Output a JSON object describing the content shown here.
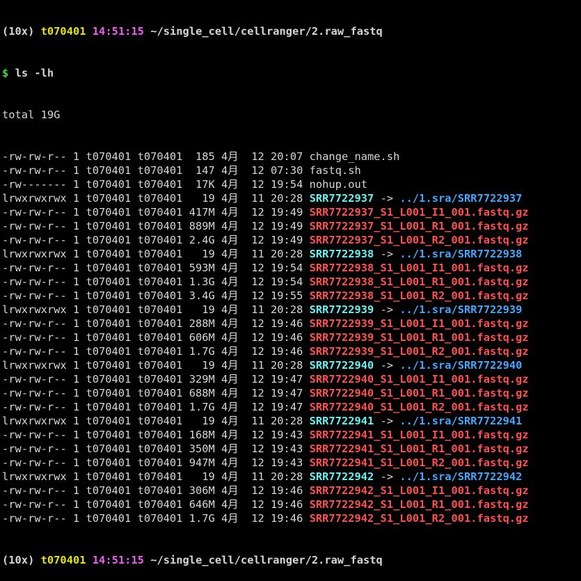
{
  "prompt": {
    "env": "(10x)",
    "user": "t070401",
    "time": "14:51:15",
    "path": "~/single_cell/cellranger/2.raw_fastq",
    "dollar": "$",
    "command": "ls -lh"
  },
  "total": "total 19G",
  "entries": [
    {
      "perm": "-rw-rw-r--",
      "links": "1",
      "owner": "t070401",
      "group": "t070401",
      "size": "185",
      "month": "4月",
      "day": "12",
      "time": "20:07",
      "name": "change_name.sh",
      "kind": "plain"
    },
    {
      "perm": "-rw-rw-r--",
      "links": "1",
      "owner": "t070401",
      "group": "t070401",
      "size": "147",
      "month": "4月",
      "day": "12",
      "time": "07:30",
      "name": "fastq.sh",
      "kind": "plain"
    },
    {
      "perm": "-rw-------",
      "links": "1",
      "owner": "t070401",
      "group": "t070401",
      "size": "17K",
      "month": "4月",
      "day": "12",
      "time": "19:54",
      "name": "nohup.out",
      "kind": "plain"
    },
    {
      "perm": "lrwxrwxrwx",
      "links": "1",
      "owner": "t070401",
      "group": "t070401",
      "size": "19",
      "month": "4月",
      "day": "11",
      "time": "20:28",
      "name": "SRR7722937",
      "kind": "link",
      "target": "../1.sra/SRR7722937"
    },
    {
      "perm": "-rw-rw-r--",
      "links": "1",
      "owner": "t070401",
      "group": "t070401",
      "size": "417M",
      "month": "4月",
      "day": "12",
      "time": "19:49",
      "name": "SRR7722937_S1_L001_I1_001.fastq.gz",
      "kind": "gz"
    },
    {
      "perm": "-rw-rw-r--",
      "links": "1",
      "owner": "t070401",
      "group": "t070401",
      "size": "889M",
      "month": "4月",
      "day": "12",
      "time": "19:49",
      "name": "SRR7722937_S1_L001_R1_001.fastq.gz",
      "kind": "gz"
    },
    {
      "perm": "-rw-rw-r--",
      "links": "1",
      "owner": "t070401",
      "group": "t070401",
      "size": "2.4G",
      "month": "4月",
      "day": "12",
      "time": "19:49",
      "name": "SRR7722937_S1_L001_R2_001.fastq.gz",
      "kind": "gz"
    },
    {
      "perm": "lrwxrwxrwx",
      "links": "1",
      "owner": "t070401",
      "group": "t070401",
      "size": "19",
      "month": "4月",
      "day": "11",
      "time": "20:28",
      "name": "SRR7722938",
      "kind": "link",
      "target": "../1.sra/SRR7722938"
    },
    {
      "perm": "-rw-rw-r--",
      "links": "1",
      "owner": "t070401",
      "group": "t070401",
      "size": "593M",
      "month": "4月",
      "day": "12",
      "time": "19:54",
      "name": "SRR7722938_S1_L001_I1_001.fastq.gz",
      "kind": "gz"
    },
    {
      "perm": "-rw-rw-r--",
      "links": "1",
      "owner": "t070401",
      "group": "t070401",
      "size": "1.3G",
      "month": "4月",
      "day": "12",
      "time": "19:54",
      "name": "SRR7722938_S1_L001_R1_001.fastq.gz",
      "kind": "gz"
    },
    {
      "perm": "-rw-rw-r--",
      "links": "1",
      "owner": "t070401",
      "group": "t070401",
      "size": "3.4G",
      "month": "4月",
      "day": "12",
      "time": "19:55",
      "name": "SRR7722938_S1_L001_R2_001.fastq.gz",
      "kind": "gz"
    },
    {
      "perm": "lrwxrwxrwx",
      "links": "1",
      "owner": "t070401",
      "group": "t070401",
      "size": "19",
      "month": "4月",
      "day": "11",
      "time": "20:28",
      "name": "SRR7722939",
      "kind": "link",
      "target": "../1.sra/SRR7722939"
    },
    {
      "perm": "-rw-rw-r--",
      "links": "1",
      "owner": "t070401",
      "group": "t070401",
      "size": "288M",
      "month": "4月",
      "day": "12",
      "time": "19:46",
      "name": "SRR7722939_S1_L001_I1_001.fastq.gz",
      "kind": "gz"
    },
    {
      "perm": "-rw-rw-r--",
      "links": "1",
      "owner": "t070401",
      "group": "t070401",
      "size": "606M",
      "month": "4月",
      "day": "12",
      "time": "19:46",
      "name": "SRR7722939_S1_L001_R1_001.fastq.gz",
      "kind": "gz"
    },
    {
      "perm": "-rw-rw-r--",
      "links": "1",
      "owner": "t070401",
      "group": "t070401",
      "size": "1.7G",
      "month": "4月",
      "day": "12",
      "time": "19:46",
      "name": "SRR7722939_S1_L001_R2_001.fastq.gz",
      "kind": "gz"
    },
    {
      "perm": "lrwxrwxrwx",
      "links": "1",
      "owner": "t070401",
      "group": "t070401",
      "size": "19",
      "month": "4月",
      "day": "11",
      "time": "20:28",
      "name": "SRR7722940",
      "kind": "link",
      "target": "../1.sra/SRR7722940"
    },
    {
      "perm": "-rw-rw-r--",
      "links": "1",
      "owner": "t070401",
      "group": "t070401",
      "size": "329M",
      "month": "4月",
      "day": "12",
      "time": "19:47",
      "name": "SRR7722940_S1_L001_I1_001.fastq.gz",
      "kind": "gz"
    },
    {
      "perm": "-rw-rw-r--",
      "links": "1",
      "owner": "t070401",
      "group": "t070401",
      "size": "688M",
      "month": "4月",
      "day": "12",
      "time": "19:47",
      "name": "SRR7722940_S1_L001_R1_001.fastq.gz",
      "kind": "gz"
    },
    {
      "perm": "-rw-rw-r--",
      "links": "1",
      "owner": "t070401",
      "group": "t070401",
      "size": "1.7G",
      "month": "4月",
      "day": "12",
      "time": "19:47",
      "name": "SRR7722940_S1_L001_R2_001.fastq.gz",
      "kind": "gz"
    },
    {
      "perm": "lrwxrwxrwx",
      "links": "1",
      "owner": "t070401",
      "group": "t070401",
      "size": "19",
      "month": "4月",
      "day": "11",
      "time": "20:28",
      "name": "SRR7722941",
      "kind": "link",
      "target": "../1.sra/SRR7722941"
    },
    {
      "perm": "-rw-rw-r--",
      "links": "1",
      "owner": "t070401",
      "group": "t070401",
      "size": "168M",
      "month": "4月",
      "day": "12",
      "time": "19:43",
      "name": "SRR7722941_S1_L001_I1_001.fastq.gz",
      "kind": "gz"
    },
    {
      "perm": "-rw-rw-r--",
      "links": "1",
      "owner": "t070401",
      "group": "t070401",
      "size": "350M",
      "month": "4月",
      "day": "12",
      "time": "19:43",
      "name": "SRR7722941_S1_L001_R1_001.fastq.gz",
      "kind": "gz"
    },
    {
      "perm": "-rw-rw-r--",
      "links": "1",
      "owner": "t070401",
      "group": "t070401",
      "size": "947M",
      "month": "4月",
      "day": "12",
      "time": "19:43",
      "name": "SRR7722941_S1_L001_R2_001.fastq.gz",
      "kind": "gz"
    },
    {
      "perm": "lrwxrwxrwx",
      "links": "1",
      "owner": "t070401",
      "group": "t070401",
      "size": "19",
      "month": "4月",
      "day": "11",
      "time": "20:28",
      "name": "SRR7722942",
      "kind": "link",
      "target": "../1.sra/SRR7722942"
    },
    {
      "perm": "-rw-rw-r--",
      "links": "1",
      "owner": "t070401",
      "group": "t070401",
      "size": "306M",
      "month": "4月",
      "day": "12",
      "time": "19:46",
      "name": "SRR7722942_S1_L001_I1_001.fastq.gz",
      "kind": "gz"
    },
    {
      "perm": "-rw-rw-r--",
      "links": "1",
      "owner": "t070401",
      "group": "t070401",
      "size": "646M",
      "month": "4月",
      "day": "12",
      "time": "19:46",
      "name": "SRR7722942_S1_L001_R1_001.fastq.gz",
      "kind": "gz"
    },
    {
      "perm": "-rw-rw-r--",
      "links": "1",
      "owner": "t070401",
      "group": "t070401",
      "size": "1.7G",
      "month": "4月",
      "day": "12",
      "time": "19:46",
      "name": "SRR7722942_S1_L001_R2_001.fastq.gz",
      "kind": "gz"
    }
  ],
  "colors": {
    "background": "#000000",
    "text": "#d6d6d6",
    "prompt_user": "#e5e500",
    "prompt_time": "#ee5df2",
    "prompt_dollar": "#3fe03f",
    "symlink": "#63f3f2",
    "link_target": "#43a7ff",
    "archive": "#ff4f4f"
  }
}
